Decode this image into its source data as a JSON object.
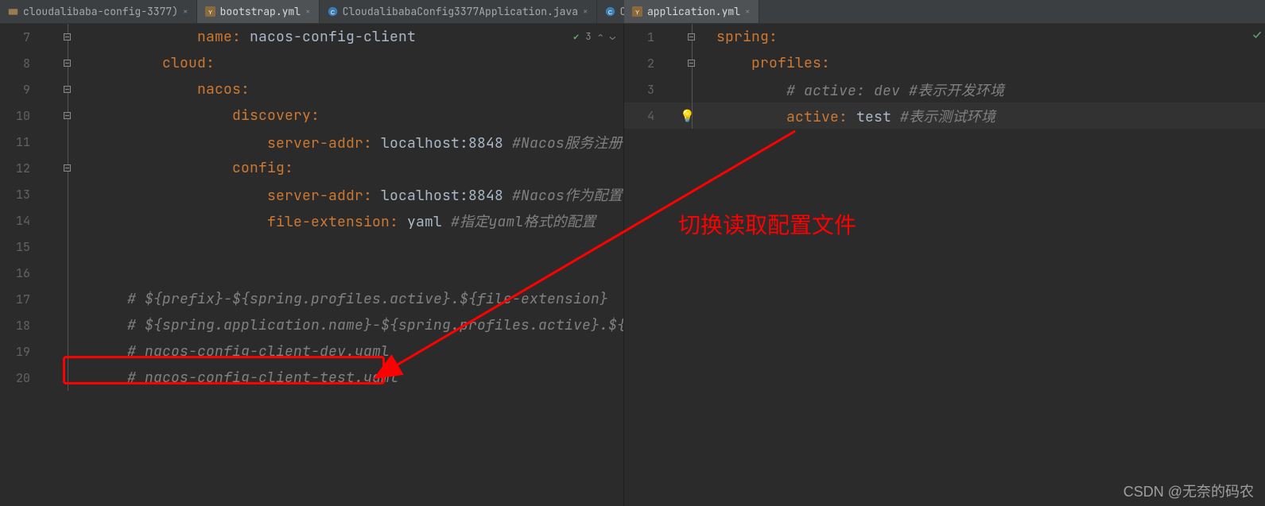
{
  "tabs": {
    "left": [
      {
        "label": "cloudalibaba-config-3377)",
        "icon": "folder",
        "active": false
      },
      {
        "label": "bootstrap.yml",
        "icon": "yml",
        "active": true
      },
      {
        "label": "CloudalibabaConfig3377Application.java",
        "icon": "java",
        "active": false
      },
      {
        "label": "ConfigController.java",
        "icon": "java",
        "active": false
      }
    ],
    "right": [
      {
        "label": "application.yml",
        "icon": "yml",
        "active": true
      }
    ]
  },
  "status_left": {
    "warn": "3",
    "arrows": "⌃ ⌄"
  },
  "left_code": {
    "start": 7,
    "lines": [
      {
        "n": 7,
        "indent": 6,
        "tokens": [
          {
            "t": "key",
            "v": "name"
          },
          {
            "t": "col",
            "v": ": "
          },
          {
            "t": "val",
            "v": "nacos-config-client"
          }
        ],
        "fold": "minus"
      },
      {
        "n": 8,
        "indent": 4,
        "tokens": [
          {
            "t": "key",
            "v": "cloud"
          },
          {
            "t": "col",
            "v": ":"
          }
        ],
        "fold": "minus"
      },
      {
        "n": 9,
        "indent": 6,
        "tokens": [
          {
            "t": "key",
            "v": "nacos"
          },
          {
            "t": "col",
            "v": ":"
          }
        ],
        "fold": "minus"
      },
      {
        "n": 10,
        "indent": 8,
        "tokens": [
          {
            "t": "key",
            "v": "discovery"
          },
          {
            "t": "col",
            "v": ":"
          }
        ],
        "fold": "minus"
      },
      {
        "n": 11,
        "indent": 10,
        "tokens": [
          {
            "t": "key",
            "v": "server-addr"
          },
          {
            "t": "col",
            "v": ": "
          },
          {
            "t": "val",
            "v": "localhost:8848"
          },
          {
            "t": "cmt",
            "v": " #Nacos服务注册中心地址"
          }
        ]
      },
      {
        "n": 12,
        "indent": 8,
        "tokens": [
          {
            "t": "key",
            "v": "config"
          },
          {
            "t": "col",
            "v": ":"
          }
        ],
        "fold": "minus"
      },
      {
        "n": 13,
        "indent": 10,
        "tokens": [
          {
            "t": "key",
            "v": "server-addr"
          },
          {
            "t": "col",
            "v": ": "
          },
          {
            "t": "val",
            "v": "localhost:8848"
          },
          {
            "t": "cmt",
            "v": " #Nacos作为配置中心地址"
          }
        ]
      },
      {
        "n": 14,
        "indent": 10,
        "tokens": [
          {
            "t": "key",
            "v": "file-extension"
          },
          {
            "t": "col",
            "v": ": "
          },
          {
            "t": "val",
            "v": "yaml"
          },
          {
            "t": "cmt",
            "v": " #指定yaml格式的配置"
          }
        ],
        "fold": "end"
      },
      {
        "n": 15,
        "indent": 0,
        "tokens": []
      },
      {
        "n": 16,
        "indent": 0,
        "tokens": []
      },
      {
        "n": 17,
        "indent": 2,
        "tokens": [
          {
            "t": "cmt",
            "v": "# ${prefix}-${spring.profiles.active}.${file-extension}"
          }
        ]
      },
      {
        "n": 18,
        "indent": 2,
        "tokens": [
          {
            "t": "cmt",
            "v": "# ${spring.application.name}-${spring.profiles.active}.${fi"
          }
        ]
      },
      {
        "n": 19,
        "indent": 2,
        "tokens": [
          {
            "t": "cmt",
            "v": "# nacos-config-client-dev.yaml"
          }
        ]
      },
      {
        "n": 20,
        "indent": 2,
        "tokens": [
          {
            "t": "cmt",
            "v": "# nacos-config-client-test.yaml"
          }
        ]
      }
    ]
  },
  "right_code": {
    "start": 1,
    "lines": [
      {
        "n": 1,
        "indent": 0,
        "tokens": [
          {
            "t": "key",
            "v": "spring"
          },
          {
            "t": "col",
            "v": ":"
          }
        ],
        "fold": "minus"
      },
      {
        "n": 2,
        "indent": 2,
        "tokens": [
          {
            "t": "key",
            "v": "profiles"
          },
          {
            "t": "col",
            "v": ":"
          }
        ],
        "fold": "minus"
      },
      {
        "n": 3,
        "indent": 4,
        "tokens": [
          {
            "t": "cmt",
            "v": "# active: dev #表示开发环境"
          }
        ]
      },
      {
        "n": 4,
        "indent": 4,
        "hl": true,
        "bulb": true,
        "tokens": [
          {
            "t": "key",
            "v": "active"
          },
          {
            "t": "col",
            "v": ": "
          },
          {
            "t": "val",
            "v": "test"
          },
          {
            "t": "cmt",
            "v": " #表示测试环境"
          }
        ],
        "fold": "end"
      }
    ]
  },
  "annotation": {
    "text": "切换读取配置文件"
  },
  "watermark": "CSDN @无奈的码农"
}
